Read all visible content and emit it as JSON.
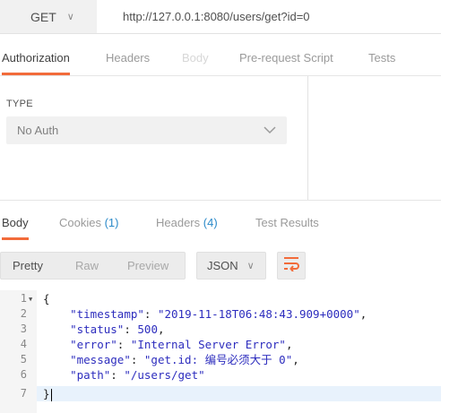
{
  "request": {
    "method": "GET",
    "url": "http://127.0.0.1:8080/users/get?id=0"
  },
  "request_tabs": [
    {
      "label": "Authorization",
      "active": true
    },
    {
      "label": "Headers"
    },
    {
      "label": "Body",
      "disabled": true
    },
    {
      "label": "Pre-request Script"
    },
    {
      "label": "Tests"
    }
  ],
  "auth": {
    "type_label": "TYPE",
    "selected": "No Auth"
  },
  "response_tabs": {
    "body": "Body",
    "cookies": "Cookies",
    "cookies_count": "(1)",
    "headers": "Headers",
    "headers_count": "(4)",
    "test_results": "Test Results"
  },
  "view_modes": [
    "Pretty",
    "Raw",
    "Preview"
  ],
  "format": "JSON",
  "code_lines": [
    {
      "num": "1",
      "text": "{"
    },
    {
      "num": "2",
      "key": "\"timestamp\"",
      "value": "\"2019-11-18T06:48:43.909+0000\"",
      "trail": ","
    },
    {
      "num": "3",
      "key": "\"status\"",
      "value": "500",
      "trail": ","
    },
    {
      "num": "4",
      "key": "\"error\"",
      "value": "\"Internal Server Error\"",
      "trail": ","
    },
    {
      "num": "5",
      "key": "\"message\"",
      "value": "\"get.id: 编号必须大于 0\"",
      "trail": ","
    },
    {
      "num": "6",
      "key": "\"path\"",
      "value": "\"/users/get\"",
      "trail": ""
    },
    {
      "num": "7",
      "text": "}"
    }
  ],
  "colors": {
    "accent": "#f26b3a",
    "count": "#2b8ac9"
  }
}
